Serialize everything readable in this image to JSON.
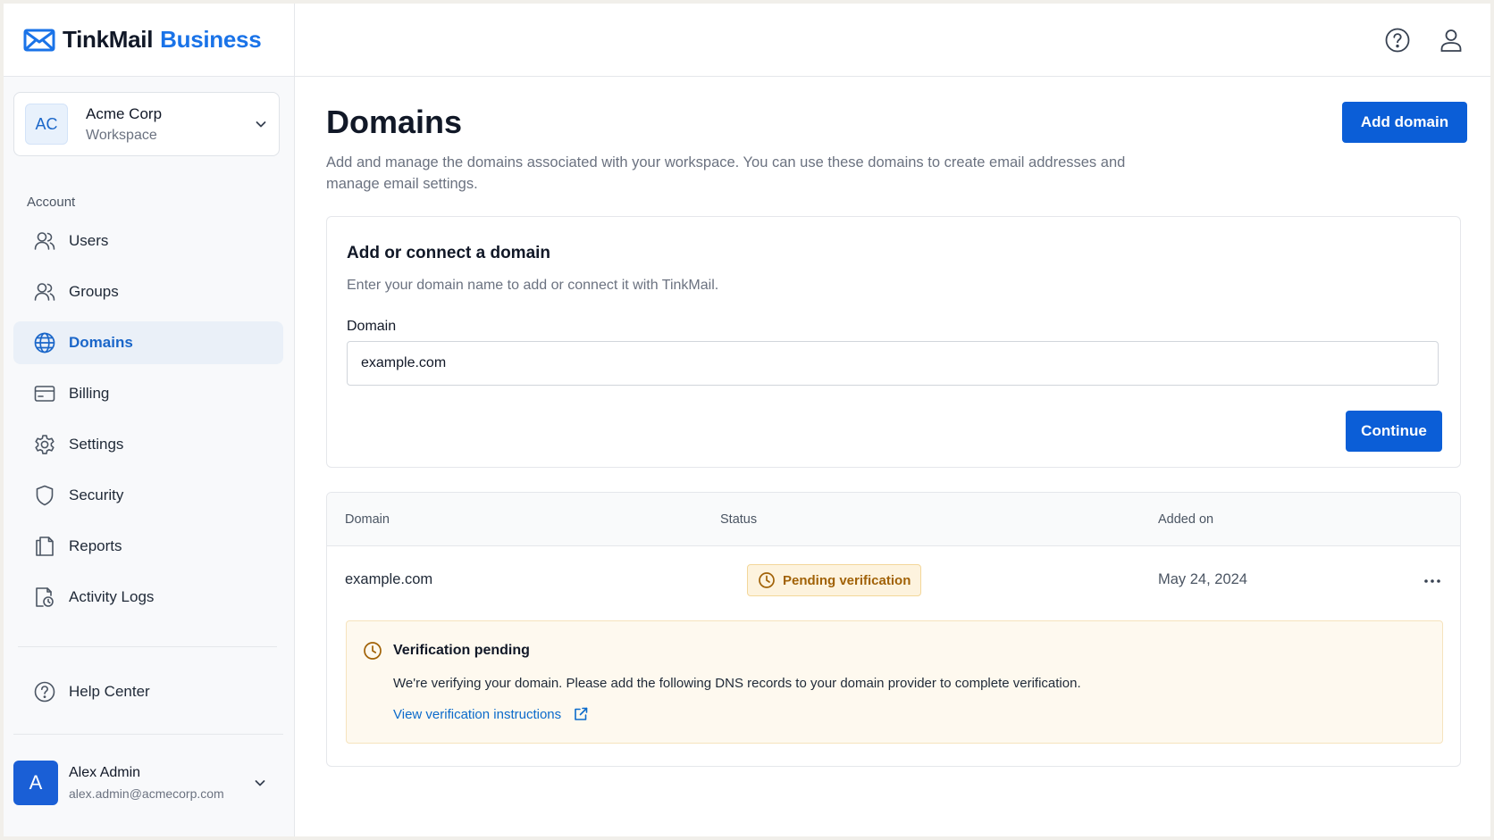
{
  "brand": {
    "name": "TinkMail",
    "sub": "Business",
    "accent": "#1a73e8"
  },
  "workspace": {
    "initials": "AC",
    "name": "Acme Corp",
    "sub": "Workspace"
  },
  "sidebar": {
    "section_label": "Account",
    "items": [
      {
        "label": "Users",
        "icon": "users-icon"
      },
      {
        "label": "Groups",
        "icon": "groups-icon"
      },
      {
        "label": "Domains",
        "icon": "globe-icon",
        "active": true
      },
      {
        "label": "Billing",
        "icon": "credit-card-icon"
      },
      {
        "label": "Settings",
        "icon": "gear-icon"
      },
      {
        "label": "Security",
        "icon": "shield-icon"
      },
      {
        "label": "Reports",
        "icon": "reports-icon"
      },
      {
        "label": "Activity Logs",
        "icon": "activity-log-icon"
      }
    ],
    "help": {
      "label": "Help Center",
      "icon": "help-circle-icon"
    }
  },
  "user": {
    "initial": "A",
    "name": "Alex Admin",
    "email": "alex.admin@acmecorp.com"
  },
  "page": {
    "title": "Domains",
    "description": "Add and manage the domains associated with your workspace. You can use these domains to create email addresses and manage email settings.",
    "add_button": "Add domain"
  },
  "connect_card": {
    "title": "Add or connect a domain",
    "subtitle": "Enter your domain name to add or connect it with TinkMail.",
    "field_label": "Domain",
    "field_value": "example.com",
    "continue_button": "Continue"
  },
  "table": {
    "headers": [
      "Domain",
      "Status",
      "Added on"
    ],
    "rows": [
      {
        "domain": "example.com",
        "status": "Pending verification",
        "added_on": "May 24, 2024"
      }
    ]
  },
  "notice": {
    "title": "Verification pending",
    "text": "We're verifying your domain. Please add the following DNS records to your domain provider to complete verification.",
    "link": "View verification instructions"
  },
  "colors": {
    "primary": "#0b5ed7",
    "active_nav_bg": "#eaf0f8",
    "warning_bg": "#fef9ef",
    "warning_text": "#a16207"
  }
}
